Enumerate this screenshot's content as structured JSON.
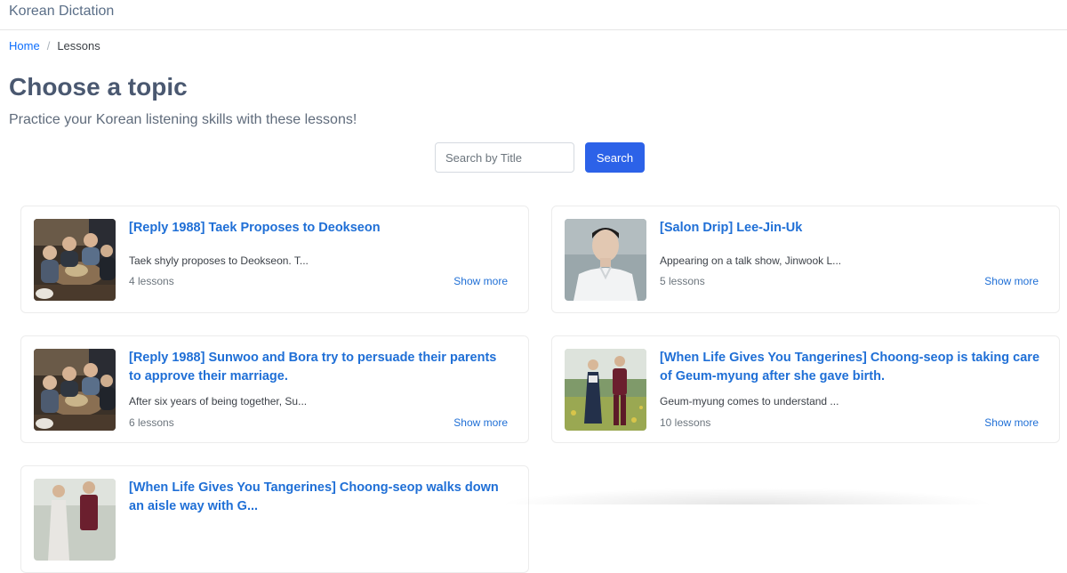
{
  "header": {
    "brand": "Korean Dictation"
  },
  "breadcrumb": {
    "home": "Home",
    "separator": "/",
    "current": "Lessons"
  },
  "page": {
    "title": "Choose a topic",
    "subtitle": "Practice your Korean listening skills with these lessons!"
  },
  "search": {
    "placeholder": "Search by Title",
    "value": "",
    "button_label": "Search"
  },
  "colors": {
    "accent": "#2c62e8",
    "link": "#1f6fd6",
    "title": "#4a5870"
  },
  "cards": [
    {
      "title": "[Reply 1988] Taek Proposes to Deokseon",
      "description": "Taek shyly proposes to Deokseon. T...",
      "lessons": "4 lessons",
      "more": "Show more"
    },
    {
      "title": "[Salon Drip] Lee-Jin-Uk",
      "description": "Appearing on a talk show, Jinwook L...",
      "lessons": "5 lessons",
      "more": "Show more"
    },
    {
      "title": "[Reply 1988] Sunwoo and Bora try to persuade their parents to approve their marriage.",
      "description": "After six years of being together, Su...",
      "lessons": "6 lessons",
      "more": "Show more"
    },
    {
      "title": "[When Life Gives You Tangerines] Choong-seop is taking care of Geum-myung after she gave birth.",
      "description": "Geum-myung comes to understand ...",
      "lessons": "10 lessons",
      "more": "Show more"
    },
    {
      "title": "[When Life Gives You Tangerines] Choong-seop walks down an aisle way with G...",
      "description": "",
      "lessons": "",
      "more": ""
    }
  ]
}
